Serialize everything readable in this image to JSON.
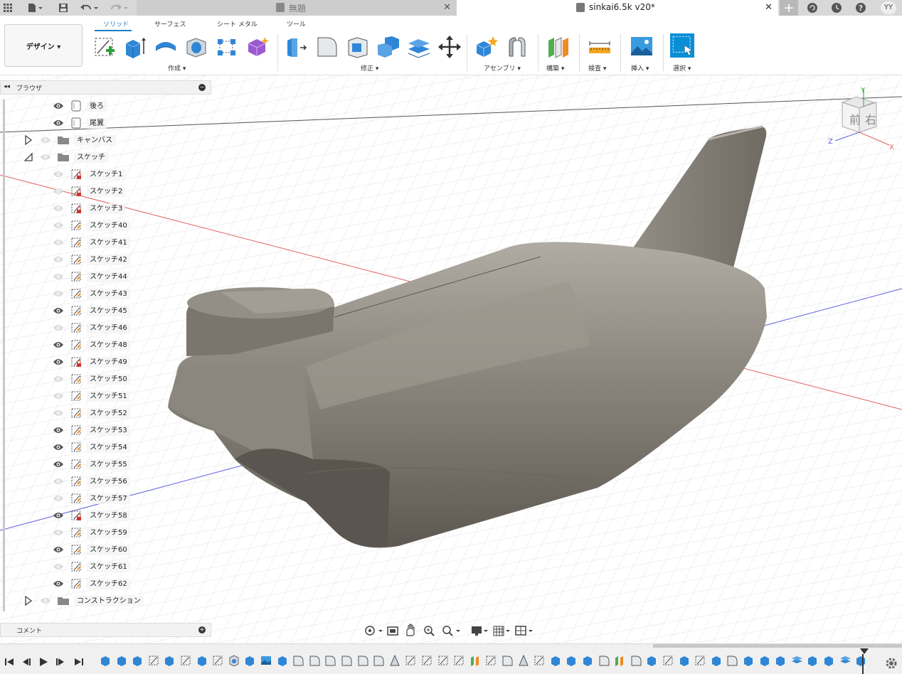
{
  "titlebar": {
    "tabs": [
      {
        "label": "無題",
        "active": false
      },
      {
        "label": "sinkai6.5k v20*",
        "active": true
      }
    ],
    "close_glyph": "✕",
    "user_initials": "YY"
  },
  "toolbar": {
    "workspace_label": "デザイン ▾",
    "ribbon_tabs": [
      "ソリッド",
      "サーフェス",
      "シート メタル",
      "ツール"
    ],
    "active_tab": "ソリッド",
    "groups": [
      "作成 ▾",
      "修正 ▾",
      "アセンブリ ▾",
      "構築 ▾",
      "検査 ▾",
      "挿入 ▾",
      "選択 ▾"
    ]
  },
  "browser": {
    "title": "ブラウザ",
    "items": [
      {
        "label": "後ろ",
        "type": "body",
        "visible": true
      },
      {
        "label": "尾翼",
        "type": "body",
        "visible": true
      },
      {
        "label": "キャンバス",
        "type": "folder",
        "visible": false,
        "expander": "collapsed"
      },
      {
        "label": "スケッチ",
        "type": "folder",
        "visible": false,
        "expander": "expanded"
      },
      {
        "label": "スケッチ1",
        "type": "sketch-locked",
        "visible": false
      },
      {
        "label": "スケッチ2",
        "type": "sketch-locked",
        "visible": false
      },
      {
        "label": "スケッチ3",
        "type": "sketch-locked",
        "visible": false
      },
      {
        "label": "スケッチ40",
        "type": "sketch",
        "visible": false
      },
      {
        "label": "スケッチ41",
        "type": "sketch",
        "visible": false
      },
      {
        "label": "スケッチ42",
        "type": "sketch",
        "visible": false
      },
      {
        "label": "スケッチ44",
        "type": "sketch",
        "visible": false
      },
      {
        "label": "スケッチ43",
        "type": "sketch",
        "visible": false
      },
      {
        "label": "スケッチ45",
        "type": "sketch",
        "visible": true
      },
      {
        "label": "スケッチ46",
        "type": "sketch",
        "visible": false
      },
      {
        "label": "スケッチ48",
        "type": "sketch",
        "visible": true
      },
      {
        "label": "スケッチ49",
        "type": "sketch-locked",
        "visible": true
      },
      {
        "label": "スケッチ50",
        "type": "sketch",
        "visible": false
      },
      {
        "label": "スケッチ51",
        "type": "sketch",
        "visible": false
      },
      {
        "label": "スケッチ52",
        "type": "sketch",
        "visible": false
      },
      {
        "label": "スケッチ53",
        "type": "sketch",
        "visible": true
      },
      {
        "label": "スケッチ54",
        "type": "sketch",
        "visible": true
      },
      {
        "label": "スケッチ55",
        "type": "sketch",
        "visible": true
      },
      {
        "label": "スケッチ56",
        "type": "sketch",
        "visible": false
      },
      {
        "label": "スケッチ57",
        "type": "sketch",
        "visible": false
      },
      {
        "label": "スケッチ58",
        "type": "sketch-locked",
        "visible": true
      },
      {
        "label": "スケッチ59",
        "type": "sketch",
        "visible": false
      },
      {
        "label": "スケッチ60",
        "type": "sketch",
        "visible": true
      },
      {
        "label": "スケッチ61",
        "type": "sketch",
        "visible": false
      },
      {
        "label": "スケッチ62",
        "type": "sketch",
        "visible": true
      },
      {
        "label": "コンストラクション",
        "type": "folder",
        "visible": false,
        "expander": "collapsed"
      }
    ]
  },
  "viewcube": {
    "front": "前",
    "right": "右",
    "axis_x": "X",
    "axis_y": "Y",
    "axis_z": "Z"
  },
  "comments": {
    "title": "コメント"
  },
  "colors": {
    "accent": "#1a7fc6",
    "body": "#8a857c",
    "grid": "#c8c8c8",
    "select_blue": "#0a8fd6"
  }
}
